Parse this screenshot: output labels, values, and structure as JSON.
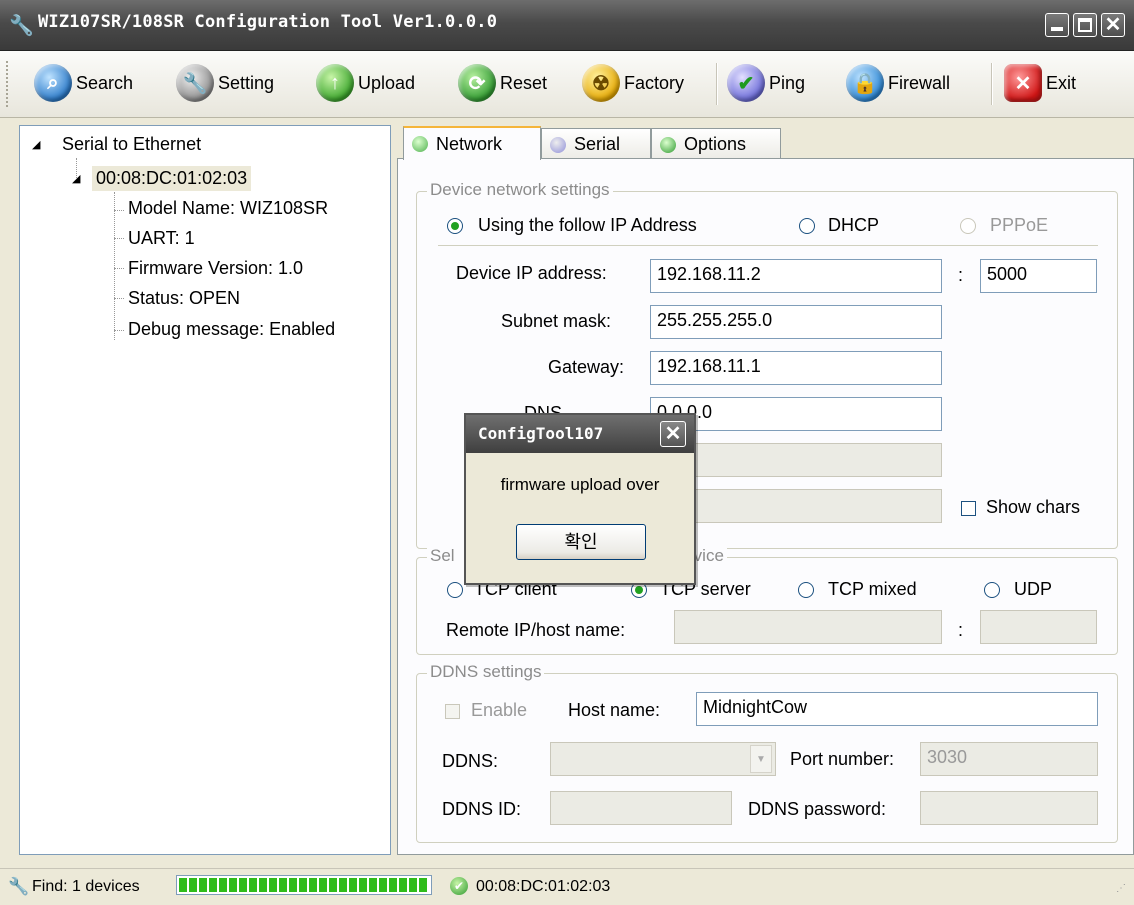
{
  "window": {
    "title": "WIZ107SR/108SR Configuration Tool Ver1.0.0.0"
  },
  "toolbar": {
    "search": "Search",
    "setting": "Setting",
    "upload": "Upload",
    "reset": "Reset",
    "factory": "Factory",
    "ping": "Ping",
    "firewall": "Firewall",
    "exit": "Exit"
  },
  "tree": {
    "root": "Serial to Ethernet",
    "device": "00:08:DC:01:02:03",
    "children": [
      "Model Name: WIZ108SR",
      "UART: 1",
      "Firmware Version: 1.0",
      "Status: OPEN",
      "Debug message: Enabled"
    ]
  },
  "tabs": {
    "network": "Network",
    "serial": "Serial",
    "options": "Options"
  },
  "network": {
    "group_title": "Device network settings",
    "radio_static": "Using the follow IP Address",
    "radio_dhcp": "DHCP",
    "radio_pppoe": "PPPoE",
    "ip_label": "Device IP address:",
    "ip_value": "192.168.11.2",
    "colon": ":",
    "port_value": "5000",
    "subnet_label": "Subnet mask:",
    "subnet_value": "255.255.255.0",
    "gateway_label": "Gateway:",
    "gateway_value": "192.168.11.1",
    "dns_label": "DNS",
    "dns_value": "0.0.0.0",
    "show_chars": "Show chars"
  },
  "mode": {
    "group_title_left": "Sel",
    "group_title_right": "e device",
    "tcp_client": "TCP client",
    "tcp_server": "TCP server",
    "tcp_mixed": "TCP mixed",
    "udp": "UDP",
    "remote_label": "Remote IP/host name:",
    "colon": ":"
  },
  "ddns": {
    "group_title": "DDNS settings",
    "enable": "Enable",
    "host_label": "Host name:",
    "host_value": "MidnightCow",
    "ddns_label": "DDNS:",
    "port_label": "Port number:",
    "port_value": "3030",
    "id_label": "DDNS ID:",
    "password_label": "DDNS password:"
  },
  "dialog": {
    "title": "ConfigTool107",
    "message": "firmware upload over",
    "ok": "확인"
  },
  "status": {
    "find": "Find: 1 devices",
    "progress": 1.0,
    "device": "00:08:DC:01:02:03"
  }
}
